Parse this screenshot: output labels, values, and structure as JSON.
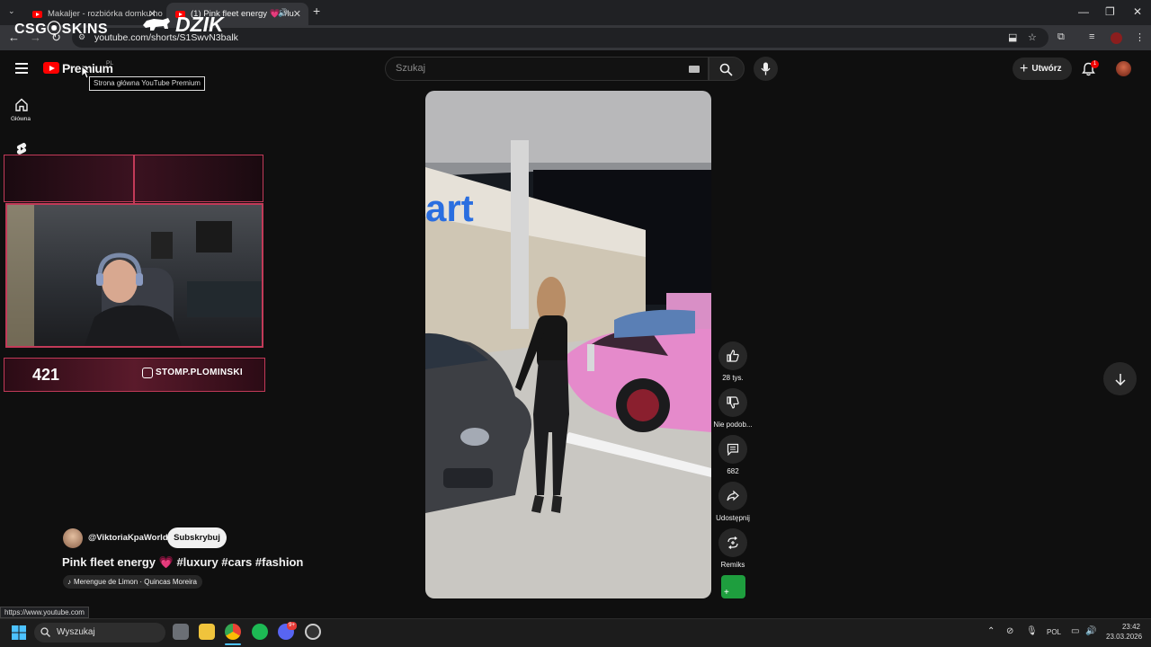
{
  "browser": {
    "tabs": [
      {
        "title": "Makaljer - rozbiórka domku ho",
        "active": false
      },
      {
        "title": "(1) Pink fleet energy 💗 #lu",
        "active": true
      }
    ],
    "new_tab": "+",
    "url": "youtube.com/shorts/S1SwvN3balk",
    "window_controls": {
      "minimize": "—",
      "restore": "❐",
      "close": "✕"
    }
  },
  "header": {
    "logo_text": "Premium",
    "region": "PL",
    "tooltip": "Strona główna YouTube Premium",
    "search_placeholder": "Szukaj",
    "create_label": "Utwórz",
    "notifications_count": "1"
  },
  "sidebar": {
    "home_label": "Główna"
  },
  "overlay": {
    "banner_left": "CSG⦿SKINS",
    "banner_right": "DZIK",
    "counter": "421",
    "instagram": "STOMP.PLOMINSKI"
  },
  "short": {
    "channel": "@ViktoriaKpaWorld",
    "subscribe": "Subskrybuj",
    "title": "Pink fleet energy 💗 #luxury #cars #fashion",
    "music": "Merengue de Limon · Quincas Moreira",
    "sign_text": "art"
  },
  "actions": {
    "likes": "28 tys.",
    "dislike": "Nie podob...",
    "comments": "682",
    "share": "Udostępnij",
    "remix": "Remiks"
  },
  "status_url": "https://www.youtube.com",
  "taskbar": {
    "search": "Wyszukaj",
    "lang": "POL",
    "time": "23:42",
    "date": "23.03.2026",
    "discord_badge": "9+"
  },
  "colors": {
    "background": "#0f0f0f",
    "accent": "#ff0000",
    "overlay_pink": "#c23a58",
    "car_pink": "#e58acb"
  }
}
